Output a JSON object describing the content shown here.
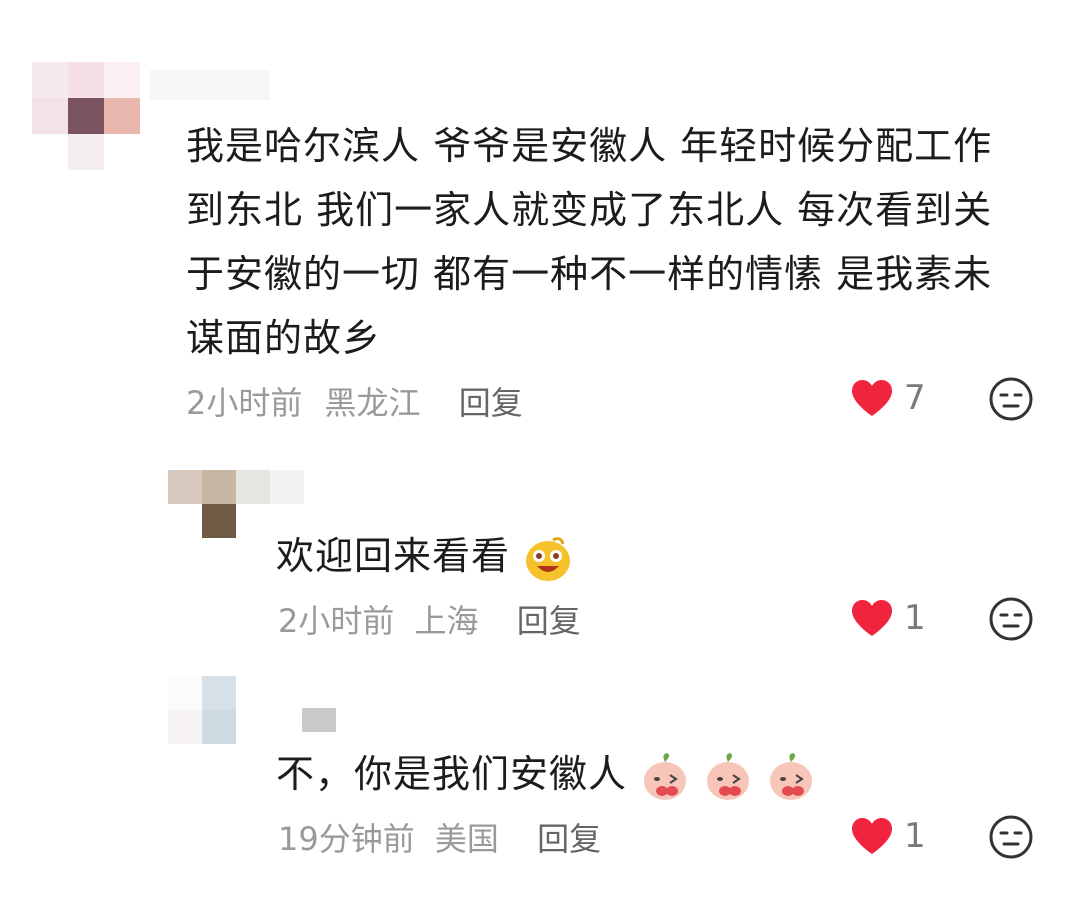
{
  "comments": [
    {
      "text": "我是哈尔滨人 爷爷是安徽人 年轻时候分配工作到东北 我们一家人就变成了东北人 每次看到关于安徽的一切 都有一种不一样的情愫 是我素未谋面的故乡",
      "time": "2小时前",
      "location": "黑龙江",
      "reply_label": "回复",
      "likes": "7",
      "icon_like": "heart-icon",
      "icon_dislike": "dislike-face-icon"
    },
    {
      "text": "欢迎回来看看",
      "emoji": "laughing-smiley-sticker",
      "time": "2小时前",
      "location": "上海",
      "reply_label": "回复",
      "likes": "1"
    },
    {
      "text": "不，你是我们安徽人",
      "emoji": "blushing-peach-sticker",
      "time": "19分钟前",
      "location": "美国",
      "reply_label": "回复",
      "likes": "1"
    }
  ],
  "colors": {
    "heart": "#f0243c",
    "text": "#1c1c1c",
    "meta": "#9a9a9a"
  }
}
